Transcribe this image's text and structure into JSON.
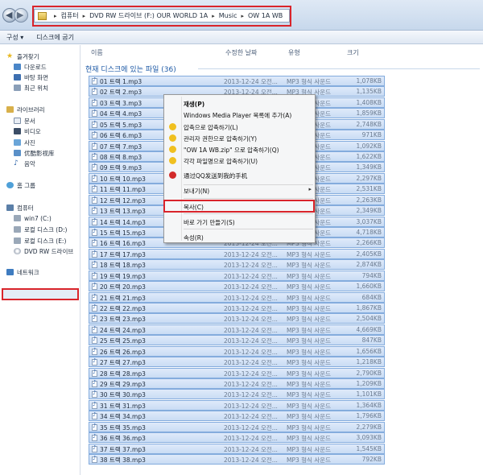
{
  "window": {
    "breadcrumbs": [
      "컴퓨터",
      "DVD RW 드라이브 (F:) OUR WORLD 1A",
      "Music",
      "OW 1A WB"
    ]
  },
  "toolbar": {
    "organize": "구성 ▾",
    "burn": "디스크에 굽기"
  },
  "columns": {
    "name": "이름",
    "modified": "수정한 날짜",
    "type": "유형",
    "size": "크기"
  },
  "sidebar": {
    "favorites": "즐겨찾기",
    "downloads": "다운로드",
    "desktop": "바탕 화면",
    "recent": "최근 위치",
    "libraries": "라이브러리",
    "documents": "문서",
    "videos": "비디오",
    "pictures": "사진",
    "excellent_films": "优酷影视库",
    "music": "음악",
    "homegroup": "홈 그룹",
    "computer": "컴퓨터",
    "drive_c": "win7 (C:)",
    "drive_d": "로컬 디스크 (D:)",
    "drive_e": "로컬 디스크 (E:)",
    "drive_f": "DVD RW 드라이브",
    "network": "네트워크"
  },
  "group_header": "현재 디스크에 있는 파일 (36)",
  "files": [
    {
      "name": "01 트랙 1.mp3",
      "date": "2013-12-24 오전...",
      "type": "MP3 형식 사운드",
      "size": "1,078KB"
    },
    {
      "name": "02 트랙 2.mp3",
      "date": "2013-12-24 오전...",
      "type": "MP3 형식 사운드",
      "size": "1,135KB"
    },
    {
      "name": "03 트랙 3.mp3",
      "date": "2013-12-24 오전...",
      "type": "MP3 형식 사운드",
      "size": "1,408KB"
    },
    {
      "name": "04 트랙 4.mp3",
      "date": "2013-12-24 오전...",
      "type": "MP3 형식 사운드",
      "size": "1,859KB"
    },
    {
      "name": "05 트랙 5.mp3",
      "date": "2013-12-24 오전...",
      "type": "MP3 형식 사운드",
      "size": "2,748KB"
    },
    {
      "name": "06 트랙 6.mp3",
      "date": "2013-12-24 오전...",
      "type": "MP3 형식 사운드",
      "size": "971KB"
    },
    {
      "name": "07 트랙 7.mp3",
      "date": "2013-12-24 오전...",
      "type": "MP3 형식 사운드",
      "size": "1,092KB"
    },
    {
      "name": "08 트랙 8.mp3",
      "date": "2013-12-24 오전...",
      "type": "MP3 형식 사운드",
      "size": "1,622KB"
    },
    {
      "name": "09 트랙 9.mp3",
      "date": "2013-12-24 오전...",
      "type": "MP3 형식 사운드",
      "size": "1,349KB"
    },
    {
      "name": "10 트랙 10.mp3",
      "date": "2013-12-24 오전...",
      "type": "MP3 형식 사운드",
      "size": "2,297KB"
    },
    {
      "name": "11 트랙 11.mp3",
      "date": "2013-12-24 오전...",
      "type": "MP3 형식 사운드",
      "size": "2,531KB"
    },
    {
      "name": "12 트랙 12.mp3",
      "date": "2013-12-24 오전...",
      "type": "MP3 형식 사운드",
      "size": "2,263KB"
    },
    {
      "name": "13 트랙 13.mp3",
      "date": "2013-12-24 오전...",
      "type": "MP3 형식 사운드",
      "size": "2,349KB"
    },
    {
      "name": "14 트랙 14.mp3",
      "date": "2013-12-24 오전...",
      "type": "MP3 형식 사운드",
      "size": "3,037KB"
    },
    {
      "name": "15 트랙 15.mp3",
      "date": "2013-12-24 오전...",
      "type": "MP3 형식 사운드",
      "size": "4,718KB"
    },
    {
      "name": "16 트랙 16.mp3",
      "date": "2013-12-24 오전...",
      "type": "MP3 형식 사운드",
      "size": "2,266KB"
    },
    {
      "name": "17 트랙 17.mp3",
      "date": "2013-12-24 오전...",
      "type": "MP3 형식 사운드",
      "size": "2,405KB"
    },
    {
      "name": "18 트랙 18.mp3",
      "date": "2013-12-24 오전...",
      "type": "MP3 형식 사운드",
      "size": "2,874KB"
    },
    {
      "name": "19 트랙 19.mp3",
      "date": "2013-12-24 오전...",
      "type": "MP3 형식 사운드",
      "size": "794KB"
    },
    {
      "name": "20 트랙 20.mp3",
      "date": "2013-12-24 오전...",
      "type": "MP3 형식 사운드",
      "size": "1,660KB"
    },
    {
      "name": "21 트랙 21.mp3",
      "date": "2013-12-24 오전...",
      "type": "MP3 형식 사운드",
      "size": "684KB"
    },
    {
      "name": "22 트랙 22.mp3",
      "date": "2013-12-24 오전...",
      "type": "MP3 형식 사운드",
      "size": "1,867KB"
    },
    {
      "name": "23 트랙 23.mp3",
      "date": "2013-12-24 오전...",
      "type": "MP3 형식 사운드",
      "size": "2,504KB"
    },
    {
      "name": "24 트랙 24.mp3",
      "date": "2013-12-24 오전...",
      "type": "MP3 형식 사운드",
      "size": "4,669KB"
    },
    {
      "name": "25 트랙 25.mp3",
      "date": "2013-12-24 오전...",
      "type": "MP3 형식 사운드",
      "size": "847KB"
    },
    {
      "name": "26 트랙 26.mp3",
      "date": "2013-12-24 오전...",
      "type": "MP3 형식 사운드",
      "size": "1,656KB"
    },
    {
      "name": "27 트랙 27.mp3",
      "date": "2013-12-24 오전...",
      "type": "MP3 형식 사운드",
      "size": "1,218KB"
    },
    {
      "name": "28 트랙 28.mp3",
      "date": "2013-12-24 오전...",
      "type": "MP3 형식 사운드",
      "size": "2,790KB"
    },
    {
      "name": "29 트랙 29.mp3",
      "date": "2013-12-24 오전...",
      "type": "MP3 형식 사운드",
      "size": "1,209KB"
    },
    {
      "name": "30 트랙 30.mp3",
      "date": "2013-12-24 오전...",
      "type": "MP3 형식 사운드",
      "size": "1,101KB"
    },
    {
      "name": "31 트랙 31.mp3",
      "date": "2013-12-24 오전...",
      "type": "MP3 형식 사운드",
      "size": "1,364KB"
    },
    {
      "name": "34 트랙 34.mp3",
      "date": "2013-12-24 오전...",
      "type": "MP3 형식 사운드",
      "size": "1,796KB"
    },
    {
      "name": "35 트랙 35.mp3",
      "date": "2013-12-24 오전...",
      "type": "MP3 형식 사운드",
      "size": "2,279KB"
    },
    {
      "name": "36 트랙 36.mp3",
      "date": "2013-12-24 오전...",
      "type": "MP3 형식 사운드",
      "size": "3,093KB"
    },
    {
      "name": "37 트랙 37.mp3",
      "date": "2013-12-24 오전...",
      "type": "MP3 형식 사운드",
      "size": "1,545KB"
    },
    {
      "name": "38 트랙 38.mp3",
      "date": "2013-12-24 오전...",
      "type": "MP3 형식 사운드",
      "size": "792KB"
    }
  ],
  "context_menu": {
    "play": "재생(P)",
    "add_wmp": "Windows Media Player 목록에 추가(A)",
    "compress": "압축으로 압축하기(L)",
    "compress_admin": "관리자 권한으로 압축하기(Y)",
    "compress_zip": "\"OW 1A WB.zip\" 으로 압축하기(Q)",
    "compress_each": "각각 파일명으로 압축하기(U)",
    "qq_send": "通过QQ发送到我的手机",
    "send_to": "보내기(N)",
    "copy": "복사(C)",
    "shortcut": "바로 가기 만들기(S)",
    "properties": "속성(R)"
  },
  "colors": {
    "highlight_red": "#d9242b",
    "selection_fill": "#c9dcf4",
    "selection_border": "#84acdd",
    "group_blue": "#1e5aa6"
  }
}
